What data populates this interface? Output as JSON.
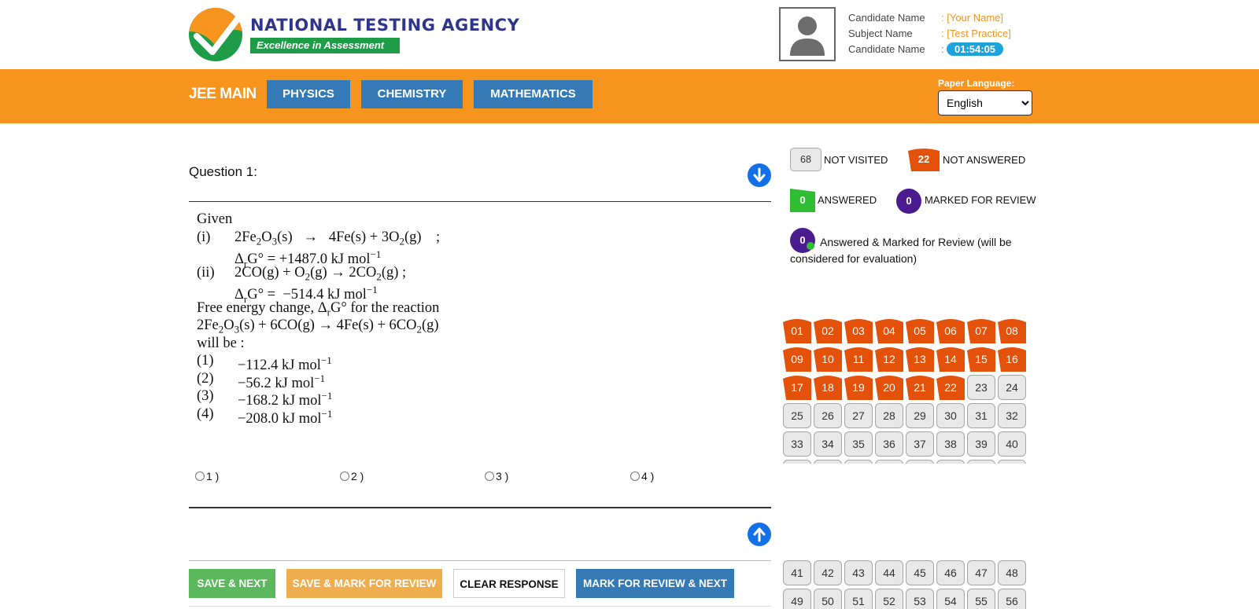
{
  "header": {
    "org_title": "NATIONAL TESTING AGENCY",
    "org_tagline": "Excellence in Assessment",
    "candidate_label": "Candidate Name",
    "candidate_value": ": [Your Name]",
    "subject_label": "Subject Name",
    "subject_value": ": [Test Practice]",
    "timer_label": "Candidate Name",
    "timer_sep": ":",
    "timer_value": "01:54:05"
  },
  "band": {
    "exam": "JEE MAIN",
    "subjects": [
      "PHYSICS",
      "CHEMISTRY",
      "MATHEMATICS"
    ],
    "language_label": "Paper Language:",
    "language_selected": "English"
  },
  "question": {
    "title": "Question 1:",
    "options": [
      "1 )",
      "2 )",
      "3 )",
      "4 )"
    ]
  },
  "actions": {
    "save_next": "SAVE & NEXT",
    "save_mark": "SAVE & MARK FOR REVIEW",
    "clear": "CLEAR RESPONSE",
    "mark_next": "MARK FOR REVIEW & NEXT"
  },
  "legend": {
    "not_visited_count": "68",
    "not_visited_label": "NOT VISITED",
    "not_answered_count": "22",
    "not_answered_label": "NOT ANSWERED",
    "answered_count": "0",
    "answered_label": "ANSWERED",
    "marked_count": "0",
    "marked_label": "MARKED FOR REVIEW",
    "answered_marked_count": "0",
    "answered_marked_label": "Answered & Marked for Review (will be considered for evaluation)"
  },
  "colors": {
    "orange": "#f7941d",
    "blue_btn": "#337ab7",
    "not_answered": "#e4510b",
    "answered": "#2fbd33",
    "marked": "#4b1c8f",
    "nta_blue": "#2f3589",
    "nta_green": "#1e9c48"
  },
  "palette": {
    "not_answered_upto": 22,
    "rows_top": [
      [
        "01",
        "02",
        "03",
        "04",
        "05",
        "06",
        "07",
        "08"
      ],
      [
        "09",
        "10",
        "11",
        "12",
        "13",
        "14",
        "15",
        "16"
      ],
      [
        "17",
        "18",
        "19",
        "20",
        "21",
        "22",
        "23",
        "24"
      ],
      [
        "25",
        "26",
        "27",
        "28",
        "29",
        "30",
        "31",
        "32"
      ],
      [
        "33",
        "34",
        "35",
        "36",
        "37",
        "38",
        "39",
        "40"
      ]
    ],
    "rows_bottom": [
      [
        "41",
        "42",
        "43",
        "44",
        "45",
        "46",
        "47",
        "48"
      ],
      [
        "49",
        "50",
        "51",
        "52",
        "53",
        "54",
        "55",
        "56"
      ]
    ]
  }
}
